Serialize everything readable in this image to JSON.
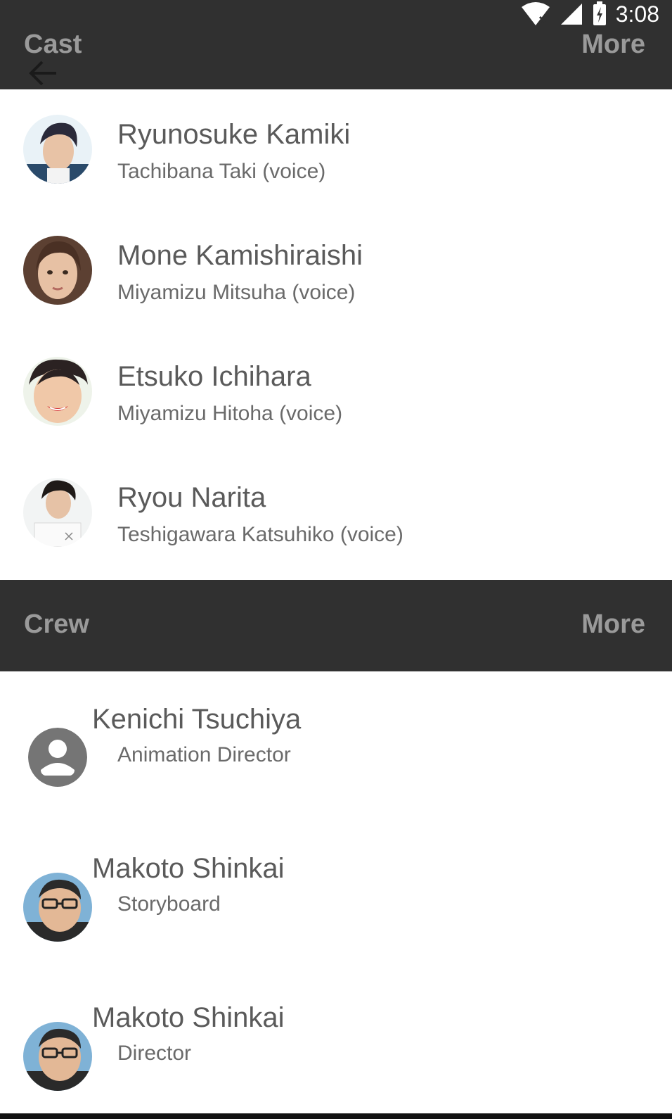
{
  "status_bar": {
    "time": "3:08"
  },
  "cast_section": {
    "title": "Cast",
    "more_label": "More",
    "items": [
      {
        "name": "Ryunosuke Kamiki",
        "role": "Tachibana Taki (voice)"
      },
      {
        "name": "Mone Kamishiraishi",
        "role": "Miyamizu Mitsuha (voice)"
      },
      {
        "name": "Etsuko Ichihara",
        "role": "Miyamizu Hitoha (voice)"
      },
      {
        "name": "Ryou Narita",
        "role": "Teshigawara Katsuhiko (voice)"
      }
    ]
  },
  "crew_section": {
    "title": "Crew",
    "more_label": "More",
    "items": [
      {
        "name": "Kenichi Tsuchiya",
        "role": "Animation Director",
        "avatar": "person-placeholder-icon"
      },
      {
        "name": "Makoto Shinkai",
        "role": "Storyboard"
      },
      {
        "name": "Makoto Shinkai",
        "role": "Director"
      }
    ]
  },
  "colors": {
    "bar_background": "#303030",
    "bar_text": "#9a9a9a",
    "name_text": "#5a5a5a",
    "role_text": "#6a6a6a"
  }
}
